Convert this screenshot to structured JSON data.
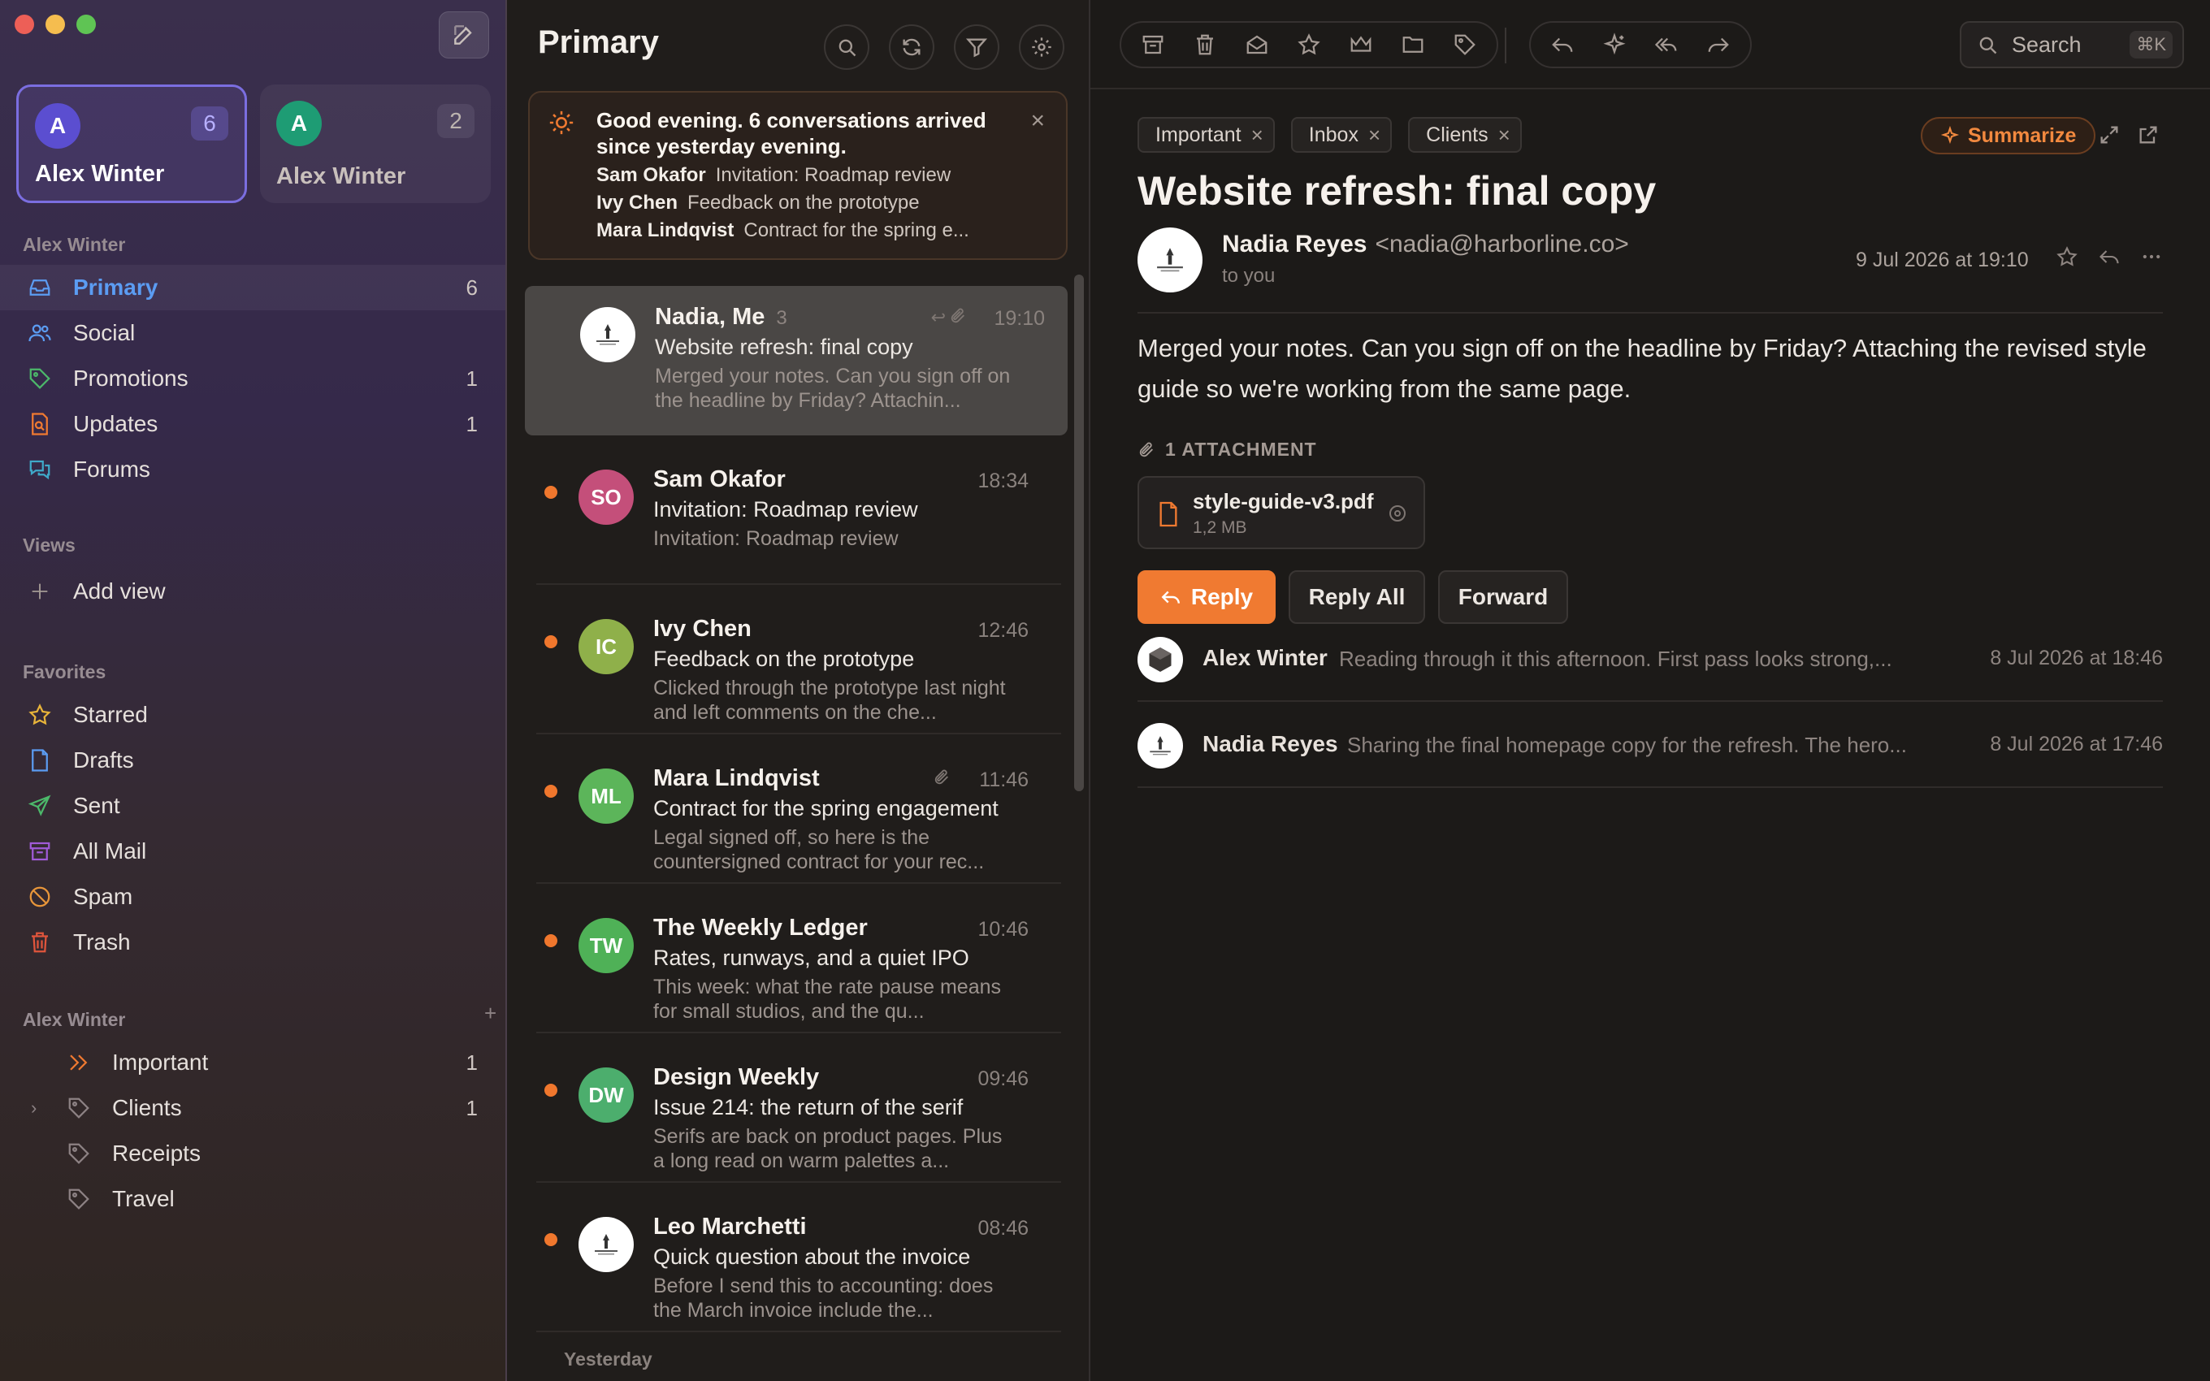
{
  "window": {
    "traffic_colors": [
      "#ed5f57",
      "#f5bd4f",
      "#5fc454"
    ]
  },
  "accounts": [
    {
      "initial": "A",
      "name": "Alex Winter",
      "count": "6",
      "color": "#5b4ed0"
    },
    {
      "initial": "A",
      "name": "Alex Winter",
      "count": "2",
      "color": "#1e9c74"
    }
  ],
  "sidebar": {
    "account_label": "Alex Winter",
    "mail_items": [
      {
        "label": "Primary",
        "count": "6",
        "icon": "inbox-icon",
        "color": "#5b9cf2"
      },
      {
        "label": "Social",
        "count": "",
        "icon": "people-icon",
        "color": "#5b9cf2"
      },
      {
        "label": "Promotions",
        "count": "1",
        "icon": "tag-icon",
        "color": "#4cb86a"
      },
      {
        "label": "Updates",
        "count": "1",
        "icon": "document-search-icon",
        "color": "#f07a31"
      },
      {
        "label": "Forums",
        "count": "",
        "icon": "chat-bubbles-icon",
        "color": "#3fa9c9"
      }
    ],
    "views_label": "Views",
    "add_view_label": "Add view",
    "favorites_label": "Favorites",
    "favorites": [
      {
        "label": "Starred",
        "icon": "star-icon",
        "color": "#e8b43a"
      },
      {
        "label": "Drafts",
        "icon": "draft-icon",
        "color": "#5b9cf2"
      },
      {
        "label": "Sent",
        "icon": "send-icon",
        "color": "#4cb86a"
      },
      {
        "label": "All Mail",
        "icon": "archive-icon",
        "color": "#a05bd8"
      },
      {
        "label": "Spam",
        "icon": "spam-icon",
        "color": "#e8963a"
      },
      {
        "label": "Trash",
        "icon": "trash-icon",
        "color": "#e0553c"
      }
    ],
    "labels_section": "Alex Winter",
    "labels": [
      {
        "label": "Important",
        "count": "1",
        "icon": "important-icon",
        "color": "#f07a31"
      },
      {
        "label": "Clients",
        "count": "1",
        "icon": "tag-icon",
        "color": "#8d8284"
      },
      {
        "label": "Receipts",
        "count": "",
        "icon": "tag-icon",
        "color": "#8d8284"
      },
      {
        "label": "Travel",
        "count": "",
        "icon": "tag-icon",
        "color": "#8d8284"
      }
    ]
  },
  "list": {
    "title": "Primary",
    "summary": {
      "title": "Good evening. 6 conversations arrived since yesterday evening.",
      "rows": [
        {
          "from": "Sam Okafor",
          "text": "Invitation: Roadmap review"
        },
        {
          "from": "Ivy Chen",
          "text": "Feedback on the prototype"
        },
        {
          "from": "Mara Lindqvist",
          "text": "Contract for the spring e..."
        }
      ]
    },
    "messages": [
      {
        "from": "Nadia, Me",
        "thread": "3",
        "time": "19:10",
        "subject": "Website refresh: final copy",
        "preview": "Merged your notes. Can you sign off on the headline by Friday? Attachin...",
        "initials": "",
        "color": "#ffffff",
        "unread": false,
        "selected": true
      },
      {
        "from": "Sam Okafor",
        "thread": "",
        "time": "18:34",
        "subject": "Invitation: Roadmap review",
        "preview": "Invitation: Roadmap review",
        "initials": "SO",
        "color": "#c44f7a",
        "unread": true
      },
      {
        "from": "Ivy Chen",
        "thread": "",
        "time": "12:46",
        "subject": "Feedback on the prototype",
        "preview": "Clicked through the prototype last night and left comments on the che...",
        "initials": "IC",
        "color": "#8fb04a",
        "unread": true
      },
      {
        "from": "Mara Lindqvist",
        "thread": "",
        "time": "11:46",
        "subject": "Contract for the spring engagement",
        "preview": "Legal signed off, so here is the countersigned contract for your rec...",
        "initials": "ML",
        "color": "#5cb55a",
        "unread": true
      },
      {
        "from": "The Weekly Ledger",
        "thread": "",
        "time": "10:46",
        "subject": "Rates, runways, and a quiet IPO",
        "preview": "This week: what the rate pause means for small studios, and the qu...",
        "initials": "TW",
        "color": "#4fb157",
        "unread": true
      },
      {
        "from": "Design Weekly",
        "thread": "",
        "time": "09:46",
        "subject": "Issue 214: the return of the serif",
        "preview": "Serifs are back on product pages. Plus a long read on warm palettes a...",
        "initials": "DW",
        "color": "#4cae6d",
        "unread": true
      },
      {
        "from": "Leo Marchetti",
        "thread": "",
        "time": "08:46",
        "subject": "Quick question about the invoice",
        "preview": "Before I send this to accounting: does the March invoice include the...",
        "initials": "",
        "color": "#ffffff",
        "unread": true
      }
    ],
    "day_label": "Yesterday"
  },
  "reader": {
    "search_placeholder": "Search",
    "search_shortcut": "⌘K",
    "chips": [
      "Important",
      "Inbox",
      "Clients"
    ],
    "summarize_label": "Summarize",
    "subject": "Website refresh: final copy",
    "sender_name": "Nadia Reyes",
    "sender_email": "<nadia@harborline.co>",
    "to": "to you",
    "date": "9 Jul 2026 at 19:10",
    "body": "Merged your notes. Can you sign off on the headline by Friday? Attaching the revised style guide so we're working from the same page.",
    "attachment_label": "1 ATTACHMENT",
    "attachment": {
      "name": "style-guide-v3.pdf",
      "size": "1,2 MB"
    },
    "reply_label": "Reply",
    "reply_all_label": "Reply All",
    "forward_label": "Forward",
    "thread": [
      {
        "name": "Alex Winter",
        "preview": "Reading through it this afternoon. First pass looks strong,...",
        "date": "8 Jul 2026 at 18:46"
      },
      {
        "name": "Nadia Reyes",
        "preview": "Sharing the final homepage copy for the refresh. The hero...",
        "date": "8 Jul 2026 at 17:46"
      }
    ],
    "accent": "#f07a31"
  }
}
